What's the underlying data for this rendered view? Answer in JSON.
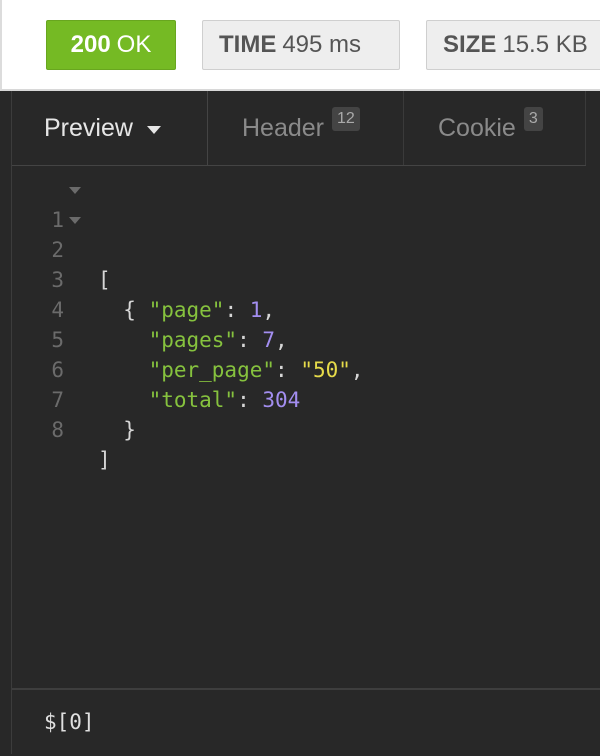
{
  "status": {
    "code": "200",
    "text": "OK",
    "color": "#75ba24"
  },
  "time": {
    "label": "TIME",
    "value": "495 ms"
  },
  "size": {
    "label": "SIZE",
    "value": "15.5 KB"
  },
  "tabs": [
    {
      "label": "Preview",
      "badge": "",
      "icon": "chevron-down-icon"
    },
    {
      "label": "Header",
      "badge": "12"
    },
    {
      "label": "Cookie",
      "badge": "3"
    }
  ],
  "code": {
    "line_numbers": [
      "1",
      "2",
      "3",
      "4",
      "5",
      "6",
      "7",
      "8"
    ],
    "line1": {
      "text": "["
    },
    "line2": {
      "text": "{"
    },
    "line3": {
      "key": "\"page\"",
      "colon": ": ",
      "value": "1",
      "comma": ","
    },
    "line4": {
      "key": "\"pages\"",
      "colon": ": ",
      "value": "7",
      "comma": ","
    },
    "line5": {
      "key": "\"per_page\"",
      "colon": ": ",
      "value": "\"50\"",
      "comma": ","
    },
    "line6": {
      "key": "\"total\"",
      "colon": ": ",
      "value": "304"
    },
    "line7": {
      "text": "}"
    },
    "line8": {
      "text": "]"
    }
  },
  "filter": {
    "value": "$[0]"
  },
  "colors": {
    "key": "#86c23e",
    "number": "#a38ef0",
    "string": "#e6db4a",
    "background": "#282828"
  }
}
